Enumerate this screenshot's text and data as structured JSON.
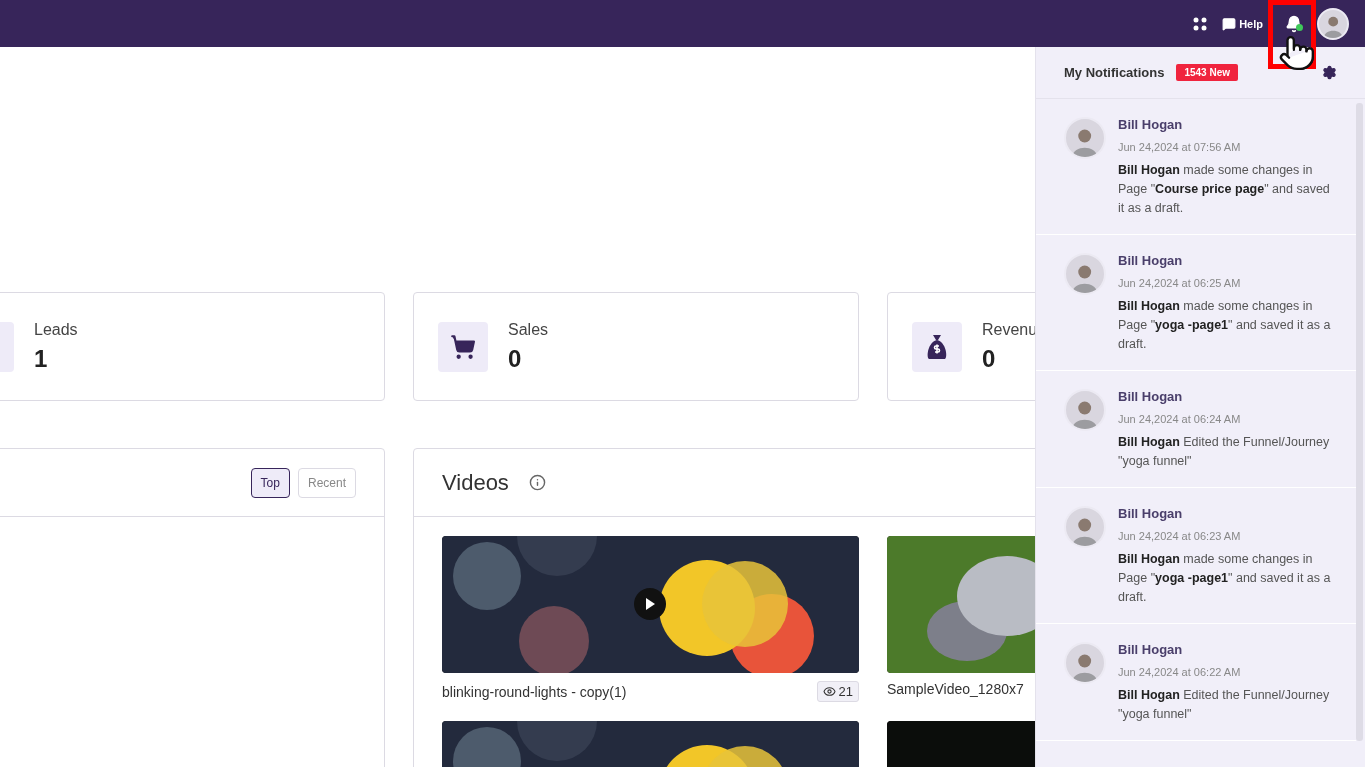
{
  "topbar": {
    "help_label": "Help",
    "has_unread": true,
    "bell_highlighted": true
  },
  "stats": [
    {
      "label": "Leads",
      "value": "1"
    },
    {
      "label": "Sales",
      "value": "0"
    },
    {
      "label": "Revenu",
      "value": "0"
    }
  ],
  "left_panel": {
    "filters": [
      {
        "label": "Top",
        "selected": true
      },
      {
        "label": "Recent",
        "selected": false
      }
    ]
  },
  "videos": {
    "title": "Videos",
    "items": [
      {
        "kind": "lights",
        "title": "blinking-round-lights - copy(1)",
        "views": "21",
        "show_play": true
      },
      {
        "kind": "nature",
        "title": "SampleVideo_1280x7"
      },
      {
        "kind": "lights"
      },
      {
        "kind": "dark"
      }
    ]
  },
  "notifications": {
    "title": "My Notifications",
    "badge": "1543 New",
    "items": [
      {
        "name": "Bill Hogan",
        "time": "Jun 24,2024 at 07:56 AM",
        "message": "**Bill Hogan** made some changes in Page \"**Course price page**\" and saved it as a draft."
      },
      {
        "name": "Bill Hogan",
        "time": "Jun 24,2024 at 06:25 AM",
        "message": "**Bill Hogan** made some changes in Page \"**yoga -page1**\" and saved it as a draft."
      },
      {
        "name": "Bill Hogan",
        "time": "Jun 24,2024 at 06:24 AM",
        "message": "**Bill Hogan** Edited the Funnel/Journey \"yoga funnel\""
      },
      {
        "name": "Bill Hogan",
        "time": "Jun 24,2024 at 06:23 AM",
        "message": "**Bill Hogan** made some changes in Page \"**yoga -page1**\" and saved it as a draft."
      },
      {
        "name": "Bill Hogan",
        "time": "Jun 24,2024 at 06:22 AM",
        "message": "**Bill Hogan** Edited the Funnel/Journey \"yoga funnel\""
      }
    ]
  }
}
